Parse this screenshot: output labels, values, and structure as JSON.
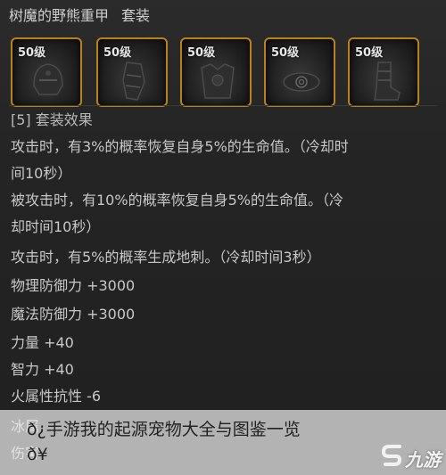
{
  "item": {
    "name": "树魔的野熊重甲",
    "set_tag": "套装"
  },
  "slots": [
    {
      "level": "50级",
      "icon": "helmet-icon"
    },
    {
      "level": "50级",
      "icon": "armor-piece-icon"
    },
    {
      "level": "50级",
      "icon": "chest-armor-icon"
    },
    {
      "level": "50级",
      "icon": "belt-icon"
    },
    {
      "level": "50级",
      "icon": "boots-icon"
    }
  ],
  "set_effects": {
    "header": "[5] 套装效果",
    "lines": [
      "攻击时，有3%的概率恢复自身5%的生命值。（冷却时",
      "间10秒）",
      "被攻击时，有10%的概率恢复自身5%的生命值。（冷",
      "却时间10秒）",
      "攻击时，有5%的概率生成地刺。（冷却时间3秒）"
    ]
  },
  "stats": [
    "物理防御力 +3000",
    "魔法防御力 +3000",
    "力量 +40",
    "智力 +40",
    "火属性抗性 -6",
    "冰属",
    "伤害"
  ],
  "overlay": {
    "caption_line1": "ð¿手游我的起源宠物大全与图鉴一览",
    "caption_line2": "ð¥",
    "watermark": "九游"
  },
  "colors": {
    "slot_border": "#b8821a",
    "text": "#c8c8c8",
    "background": "#222222"
  }
}
